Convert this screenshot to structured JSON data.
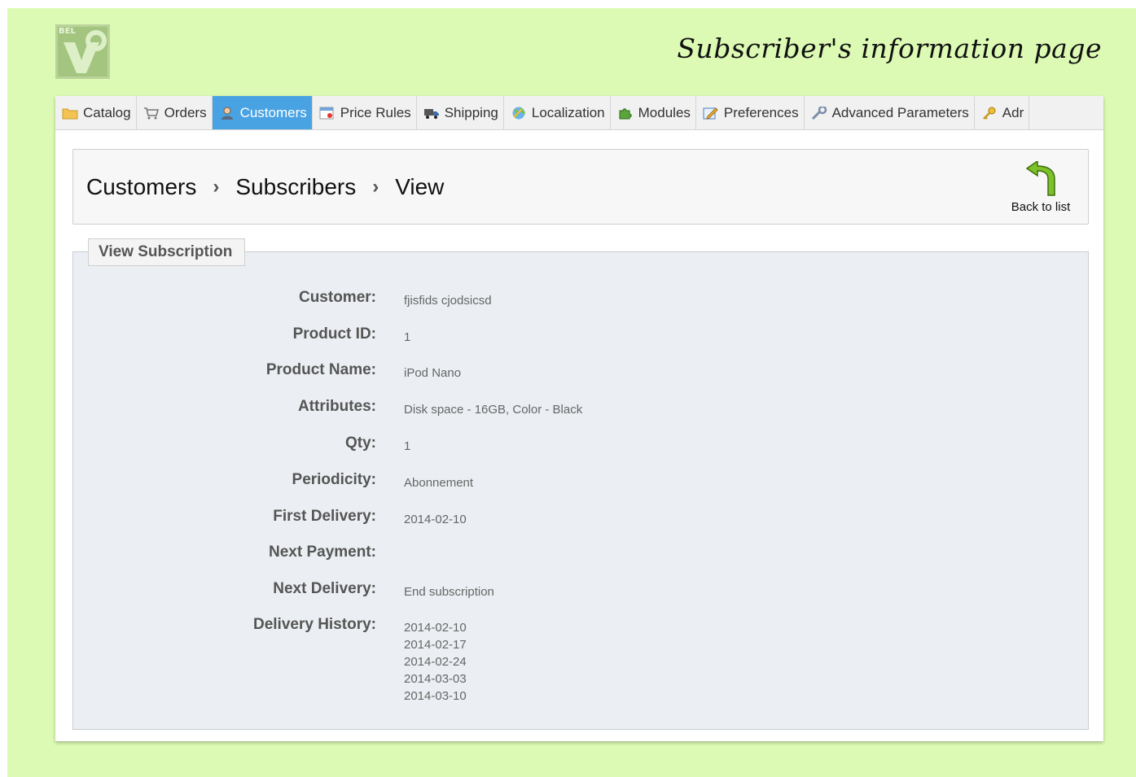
{
  "page_title": "Subscriber's  information page",
  "nav": {
    "tabs": [
      {
        "label": "Catalog",
        "icon": "folder-icon",
        "active": false
      },
      {
        "label": "Orders",
        "icon": "cart-icon",
        "active": false
      },
      {
        "label": "Customers",
        "icon": "user-icon",
        "active": true
      },
      {
        "label": "Price Rules",
        "icon": "price-tag-icon",
        "active": false
      },
      {
        "label": "Shipping",
        "icon": "truck-icon",
        "active": false
      },
      {
        "label": "Localization",
        "icon": "globe-icon",
        "active": false
      },
      {
        "label": "Modules",
        "icon": "puzzle-icon",
        "active": false
      },
      {
        "label": "Preferences",
        "icon": "edit-icon",
        "active": false
      },
      {
        "label": "Advanced Parameters",
        "icon": "wrench-icon",
        "active": false
      },
      {
        "label": "Adr",
        "icon": "key-icon",
        "active": false
      }
    ]
  },
  "breadcrumb": {
    "items": [
      "Customers",
      "Subscribers",
      "View"
    ],
    "separator": "›"
  },
  "toolbar": {
    "back_label": "Back to list"
  },
  "subscription": {
    "legend": "View Subscription",
    "fields": [
      {
        "label": "Customer:",
        "value": "fjisfids cjodsicsd"
      },
      {
        "label": "Product ID:",
        "value": "1"
      },
      {
        "label": "Product Name:",
        "value": "iPod Nano"
      },
      {
        "label": "Attributes:",
        "value": "Disk space - 16GB, Color - Black"
      },
      {
        "label": "Qty:",
        "value": "1"
      },
      {
        "label": "Periodicity:",
        "value": "Abonnement"
      },
      {
        "label": "First Delivery:",
        "value": "2014-02-10"
      },
      {
        "label": "Next Payment:",
        "value": ""
      },
      {
        "label": "Next Delivery:",
        "value": "End subscription"
      }
    ],
    "history": {
      "label": "Delivery History:",
      "dates": [
        "2014-02-10",
        "2014-02-17",
        "2014-02-24",
        "2014-03-03",
        "2014-03-10"
      ]
    }
  },
  "colors": {
    "background": "#dcfab4",
    "active_tab": "#49a3e3",
    "fieldset_bg": "#ebeef2"
  }
}
